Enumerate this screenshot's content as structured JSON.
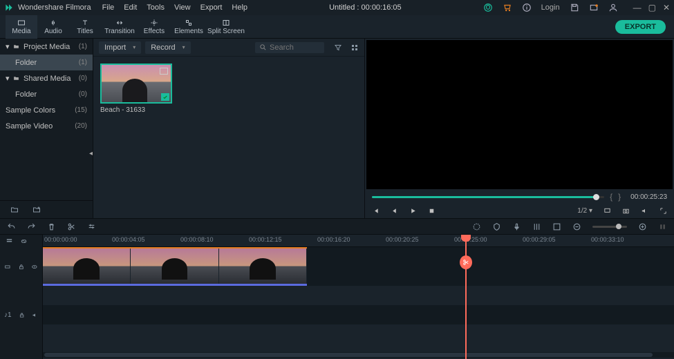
{
  "app": {
    "name": "Wondershare Filmora",
    "title": "Untitled : 00:00:16:05"
  },
  "menu": [
    "File",
    "Edit",
    "Tools",
    "View",
    "Export",
    "Help"
  ],
  "titleRight": {
    "login": "Login"
  },
  "toolbar": {
    "tabs": [
      {
        "label": "Media"
      },
      {
        "label": "Audio"
      },
      {
        "label": "Titles"
      },
      {
        "label": "Transition"
      },
      {
        "label": "Effects"
      },
      {
        "label": "Elements"
      },
      {
        "label": "Split Screen"
      }
    ],
    "export": "EXPORT"
  },
  "sidebar": {
    "items": [
      {
        "label": "Project Media",
        "count": "(1)"
      },
      {
        "label": "Folder",
        "count": "(1)"
      },
      {
        "label": "Shared Media",
        "count": "(0)"
      },
      {
        "label": "Folder",
        "count": "(0)"
      },
      {
        "label": "Sample Colors",
        "count": "(15)"
      },
      {
        "label": "Sample Video",
        "count": "(20)"
      }
    ]
  },
  "mediaPanel": {
    "import": "Import",
    "record": "Record",
    "searchPlaceholder": "Search",
    "clipName": "Beach - 31633"
  },
  "preview": {
    "duration": "00:00:25:23",
    "scale": "1/2"
  },
  "timeline": {
    "ticks": [
      "00:00:00:00",
      "00:00:04:05",
      "00:00:08:10",
      "00:00:12:15",
      "00:00:16:20",
      "00:00:20:25",
      "00:00:25:00",
      "00:00:29:05",
      "00:00:33:10"
    ],
    "audioLabel": "♪1"
  }
}
